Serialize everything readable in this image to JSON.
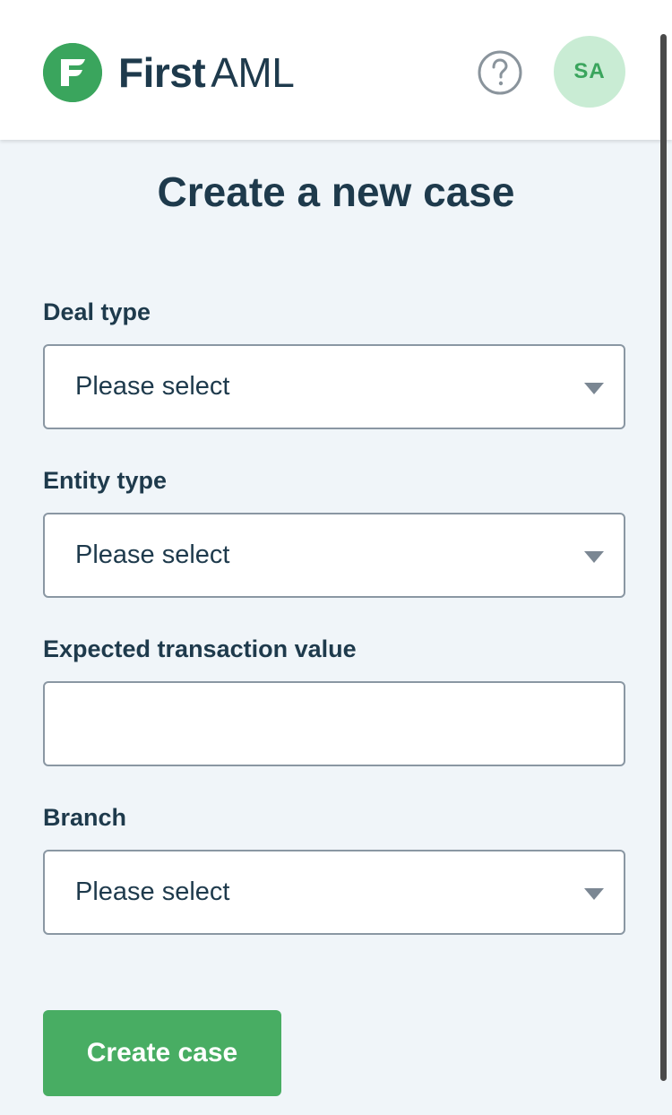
{
  "header": {
    "logo": {
      "brand_strong": "First",
      "brand_light": "AML",
      "icon": "first-aml-logo-icon"
    },
    "help_icon": "question-circle-icon",
    "avatar_initials": "SA"
  },
  "page": {
    "title": "Create a new case"
  },
  "form": {
    "deal_type": {
      "label": "Deal type",
      "value": "Please select"
    },
    "entity_type": {
      "label": "Entity type",
      "value": "Please select"
    },
    "transaction_value": {
      "label": "Expected transaction value",
      "value": ""
    },
    "branch": {
      "label": "Branch",
      "value": "Please select"
    },
    "submit_label": "Create case"
  },
  "colors": {
    "brand_green": "#3aa55d",
    "button_green": "#48ad63",
    "text_dark": "#1e3a4c",
    "background": "#f0f5f9",
    "avatar_bg": "#c9ecd4"
  }
}
